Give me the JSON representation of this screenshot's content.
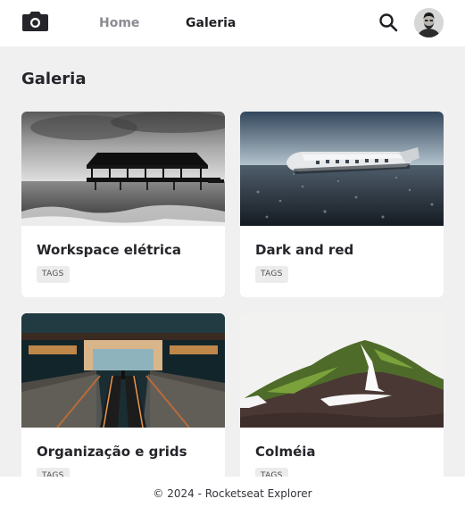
{
  "header": {
    "logo_icon": "camera-icon",
    "nav": [
      {
        "label": "Home",
        "active": false
      },
      {
        "label": "Galeria",
        "active": true
      }
    ],
    "search_icon": "search-icon",
    "avatar": "user-avatar"
  },
  "page": {
    "title": "Galeria"
  },
  "gallery": [
    {
      "title": "Workspace elétrica",
      "tag": "TAGS",
      "image": "black-and-white pier over the sea"
    },
    {
      "title": "Dark and red",
      "tag": "TAGS",
      "image": "plane wreck on black beach"
    },
    {
      "title": "Organização e grids",
      "tag": "TAGS",
      "image": "escalators in a station"
    },
    {
      "title": "Colméia",
      "tag": "TAGS",
      "image": "green mountain with snow"
    }
  ],
  "footer": {
    "text": "© 2024 - Rocketseat Explorer"
  },
  "colors": {
    "nav_active": "#1f1f24",
    "nav_inactive": "#8b8b92",
    "background": "#f0f0f0"
  }
}
